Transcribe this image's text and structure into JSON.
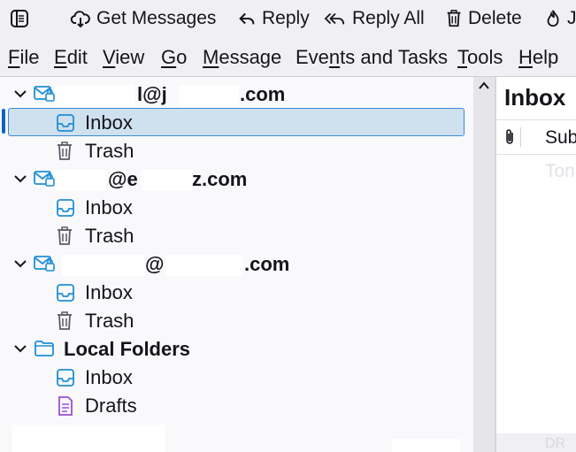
{
  "toolbar": {
    "get_messages": "Get Messages",
    "reply": "Reply",
    "reply_all": "Reply All",
    "delete": "Delete",
    "junk_partial": "J"
  },
  "menu": {
    "file": {
      "key": "F",
      "rest": "ile"
    },
    "edit": {
      "key": "E",
      "rest": "dit"
    },
    "view": {
      "key": "V",
      "rest": "iew"
    },
    "go": {
      "key": "G",
      "rest": "o"
    },
    "message": {
      "key": "M",
      "rest": "essage"
    },
    "events": {
      "pre": "Eve",
      "key": "n",
      "rest": "ts and Tasks"
    },
    "tools": {
      "key": "T",
      "rest": "ools"
    },
    "help": {
      "key": "H",
      "rest": "elp"
    }
  },
  "folders": {
    "account1": {
      "p1": "l@j",
      "p2": ".com"
    },
    "account1_inbox": "Inbox",
    "account1_trash": "Trash",
    "account2": {
      "p1": "@e",
      "p2": "z.com"
    },
    "account2_inbox": "Inbox",
    "account2_trash": "Trash",
    "account3": {
      "p1": "@",
      "p2": ".com"
    },
    "account3_inbox": "Inbox",
    "account3_trash": "Trash",
    "local": "Local Folders",
    "local_inbox": "Inbox",
    "local_drafts": "Drafts"
  },
  "right_pane": {
    "title": "Inbox",
    "subject_header_partial": "Sub",
    "row_partial": "Ton",
    "bottom_partial": "DR"
  },
  "colors": {
    "selection_bg": "#cfe0ef",
    "selection_border": "#3a8ad6",
    "focus_bar": "#0b62c9",
    "inbox_icon": "#1f8fd6",
    "drafts_icon": "#9a4fd6"
  }
}
